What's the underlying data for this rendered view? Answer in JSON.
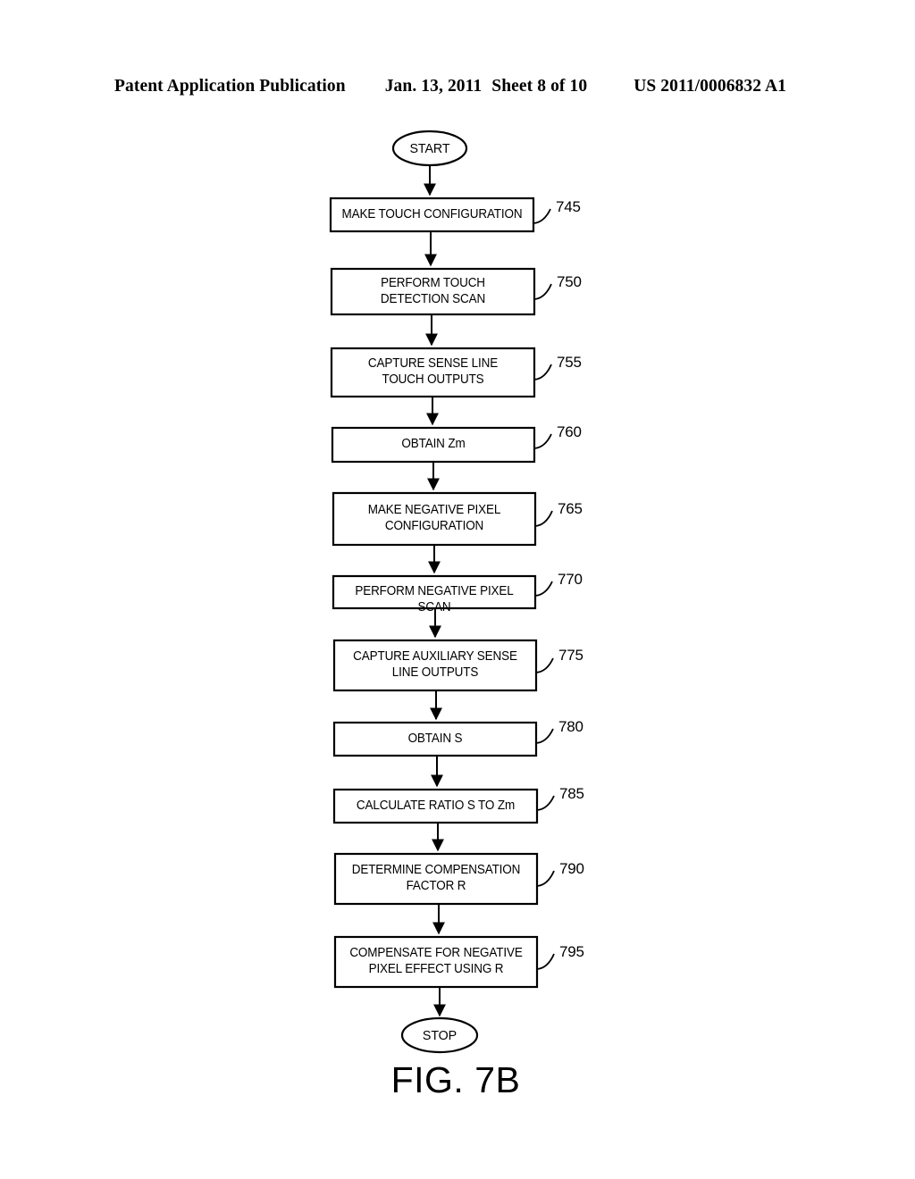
{
  "header": {
    "publication": "Patent Application Publication",
    "date": "Jan. 13, 2011",
    "sheet": "Sheet 8 of 10",
    "patent_number": "US 2011/0006832 A1"
  },
  "figure": {
    "caption": "FIG. 7B",
    "start_label": "START",
    "stop_label": "STOP",
    "steps": [
      {
        "ref": "745",
        "text": "MAKE TOUCH CONFIGURATION"
      },
      {
        "ref": "750",
        "text": "PERFORM TOUCH\nDETECTION SCAN"
      },
      {
        "ref": "755",
        "text": "CAPTURE SENSE LINE\nTOUCH OUTPUTS"
      },
      {
        "ref": "760",
        "text": "OBTAIN Zm"
      },
      {
        "ref": "765",
        "text": "MAKE NEGATIVE PIXEL\nCONFIGURATION"
      },
      {
        "ref": "770",
        "text": "PERFORM NEGATIVE PIXEL SCAN"
      },
      {
        "ref": "775",
        "text": "CAPTURE AUXILIARY SENSE\nLINE OUTPUTS"
      },
      {
        "ref": "780",
        "text": "OBTAIN S"
      },
      {
        "ref": "785",
        "text": "CALCULATE RATIO S TO Zm"
      },
      {
        "ref": "790",
        "text": "DETERMINE COMPENSATION\nFACTOR R"
      },
      {
        "ref": "795",
        "text": "COMPENSATE FOR NEGATIVE\nPIXEL EFFECT USING R"
      }
    ]
  },
  "colors": {
    "ink": "#000000",
    "page": "#ffffff"
  }
}
